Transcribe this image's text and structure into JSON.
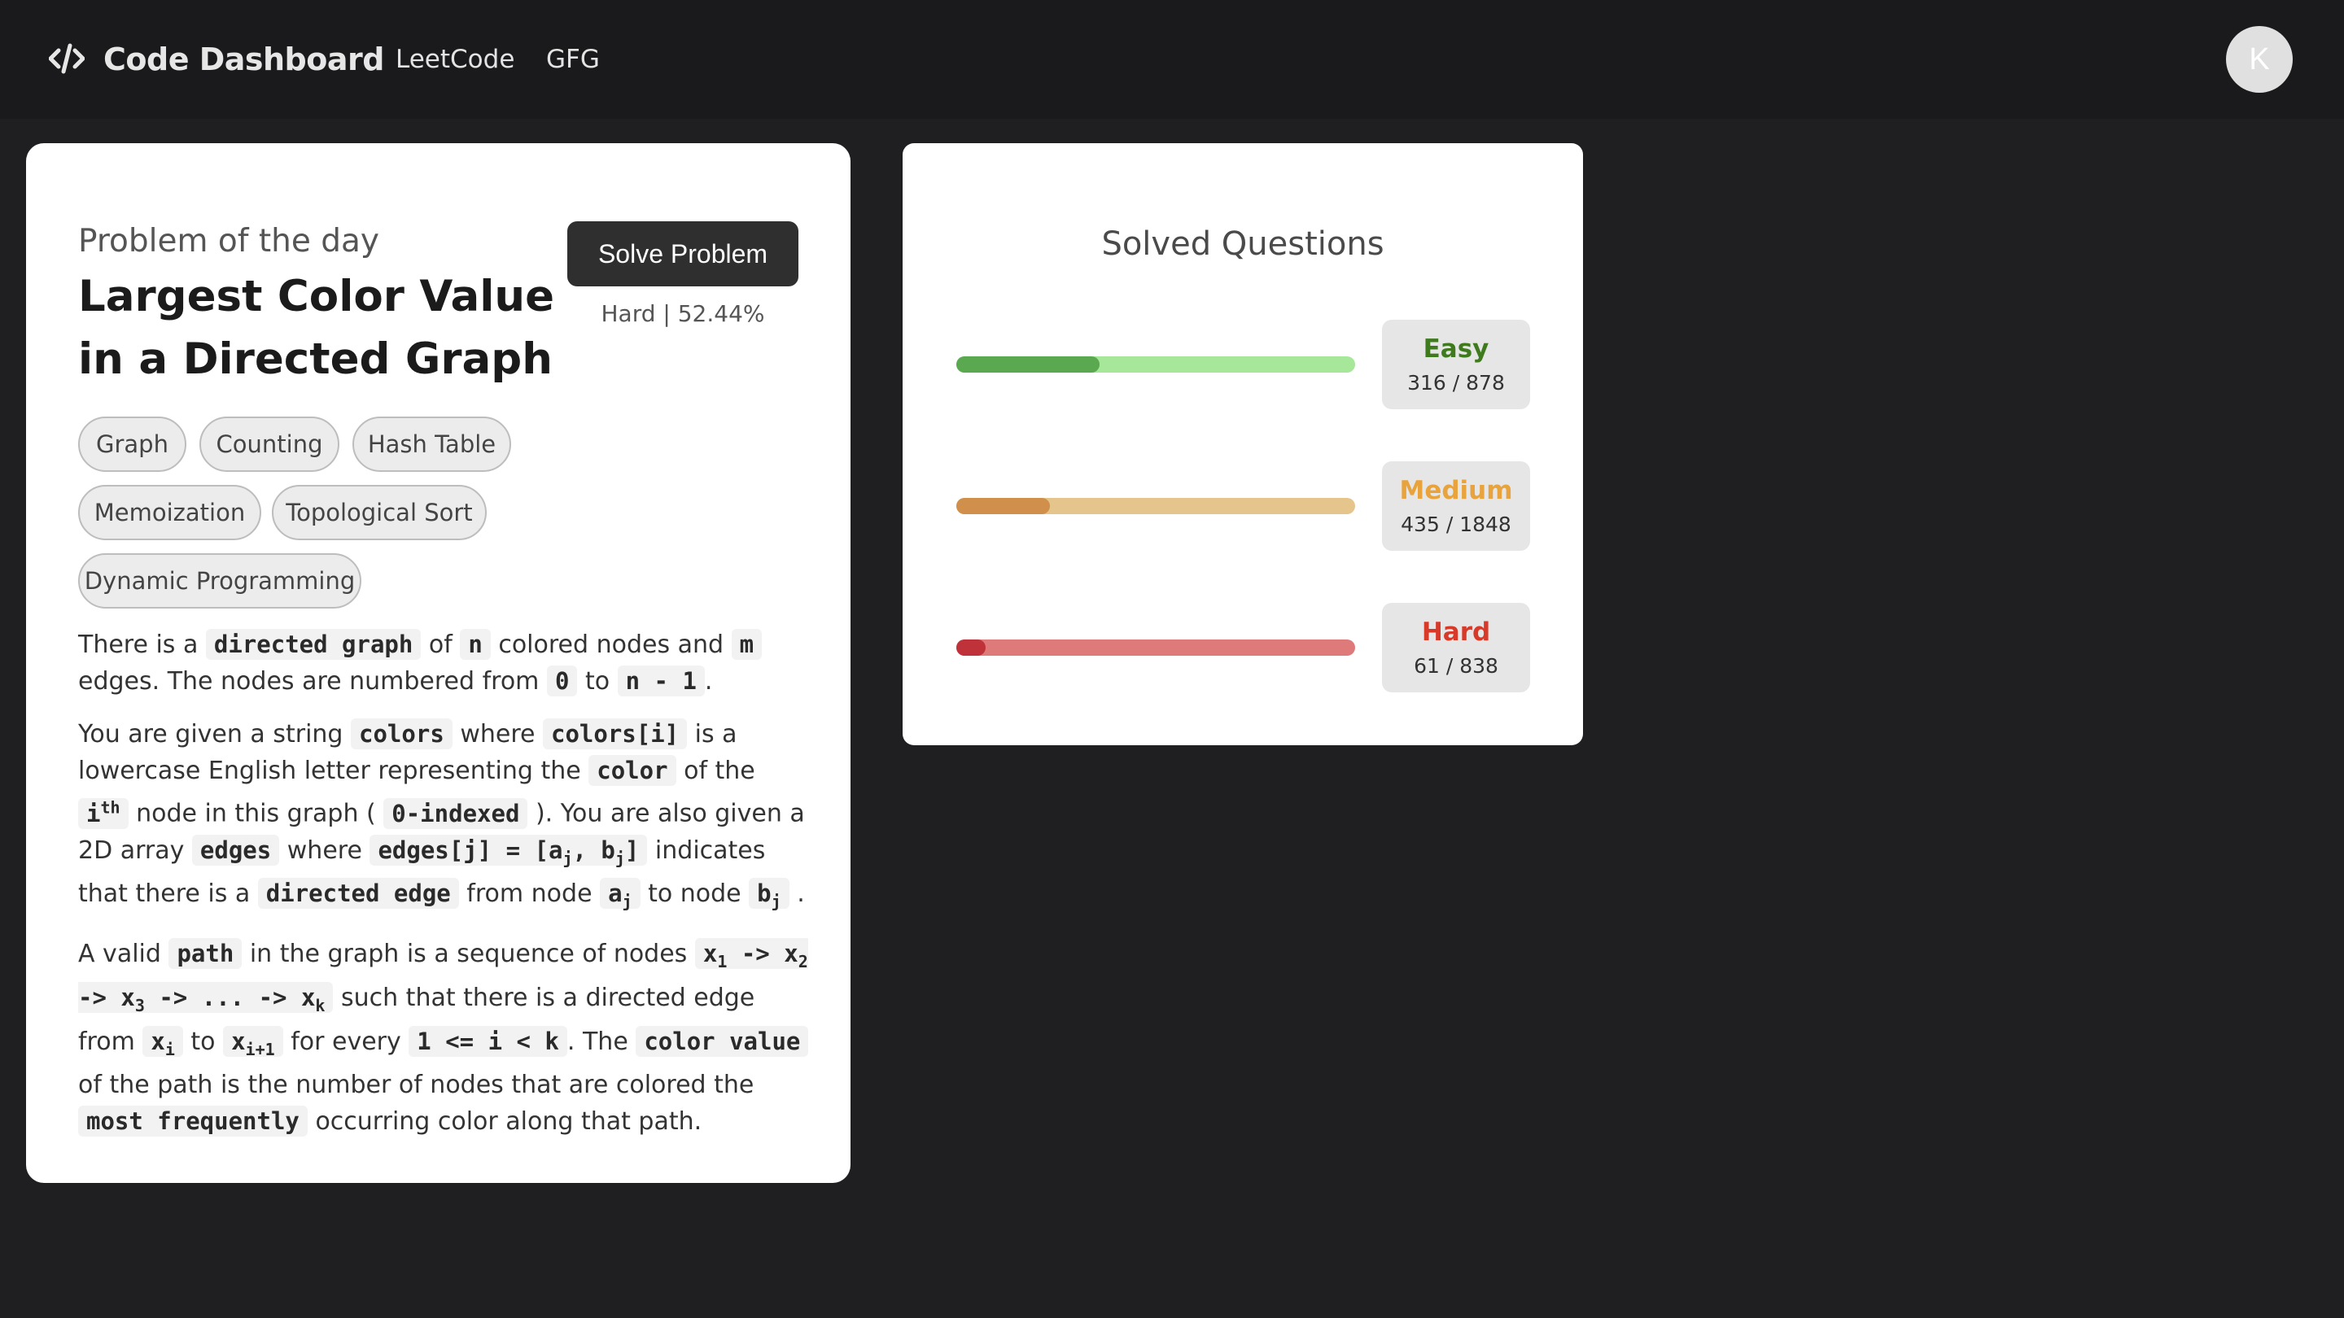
{
  "navbar": {
    "brand_icon": "code-brackets-icon",
    "brand": "Code Dashboard",
    "links": [
      "LeetCode",
      "GFG"
    ],
    "avatar_initial": "K"
  },
  "problem": {
    "label": "Problem of the day",
    "title": "Largest Color Value in a Directed Graph",
    "solve_button": "Solve Problem",
    "difficulty_line": "Hard | 52.44%",
    "tags": [
      "Graph",
      "Counting",
      "Hash Table",
      "Memoization",
      "Topological Sort",
      "Dynamic Programming"
    ],
    "description": {
      "p1": {
        "t1": "There is a ",
        "c1": "directed graph",
        "t2": " of ",
        "c2": "n",
        "t3": " colored nodes and ",
        "c3": "m",
        "t4": " edges. The nodes are numbered from ",
        "c4": "0",
        "t5": " to ",
        "c5": "n - 1",
        "t6": "."
      },
      "p2": {
        "t1": "You are given a string ",
        "c1": "colors",
        "t2": " where ",
        "c2": "colors[i]",
        "t3": " is a lowercase English letter representing the ",
        "c3": "color",
        "t4": " of the ",
        "c4": "i",
        "c4sup": "th",
        "t5": " node in this graph ( ",
        "c5": "0-indexed",
        "t6": " ). You are also given a 2D array ",
        "c6": "edges",
        "t7": " where ",
        "c7a": "edges[j] = [a",
        "c7b": "j",
        "c7c": ", b",
        "c7d": "j",
        "c7e": "]",
        "t8": " indicates that there is a ",
        "c8": "directed edge",
        "t9": " from node ",
        "c9a": "a",
        "c9b": "j",
        "t10": " to node ",
        "c10a": "b",
        "c10b": "j",
        "t11": " ."
      },
      "p3": {
        "t1": "A valid ",
        "c1": "path",
        "t2": " in the graph is a sequence of nodes ",
        "c2a": "x",
        "c2b": "1",
        "c2c": " -> x",
        "c2d": "2",
        "c2e": " -> x",
        "c2f": "3",
        "c2g": " -> ... -> x",
        "c2h": "k",
        "t3": " such that there is a directed edge from ",
        "c3a": "x",
        "c3b": "i",
        "t4": " to ",
        "c4a": "x",
        "c4b": "i+1",
        "t5": " for every ",
        "c5": "1 <= i < k",
        "t6": ". The ",
        "c6": "color value",
        "t7": " of the path is the number of nodes that are colored the ",
        "c7": "most frequently",
        "t8": " occurring color along that path."
      }
    }
  },
  "stats": {
    "title": "Solved Questions",
    "levels": [
      {
        "name": "Easy",
        "count": "316 / 878",
        "solved": 316,
        "total": 878,
        "color": "#3f7a1f",
        "track": "#a6e79a",
        "fill": "#5aa84f"
      },
      {
        "name": "Medium",
        "count": "435 / 1848",
        "solved": 435,
        "total": 1848,
        "color": "#e8a33d",
        "track": "#e6c58c",
        "fill": "#d08f4a"
      },
      {
        "name": "Hard",
        "count": "61 / 838",
        "solved": 61,
        "total": 838,
        "color": "#d83a2a",
        "track": "#de7a7a",
        "fill": "#c0323a"
      }
    ]
  }
}
